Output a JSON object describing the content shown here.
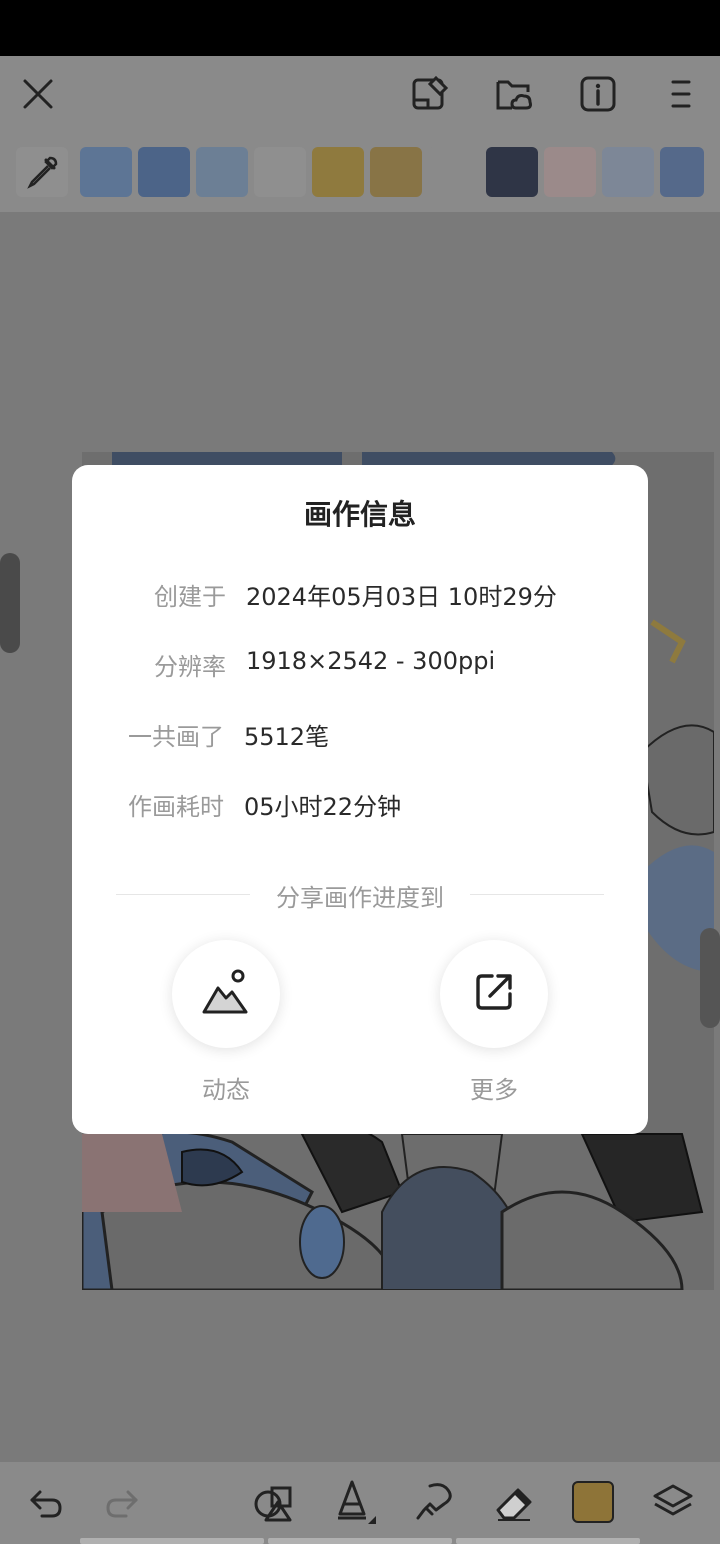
{
  "toolbar": {
    "icons": [
      "close-icon",
      "import-icon",
      "cloud-folder-icon",
      "info-icon",
      "menu-icon"
    ]
  },
  "palette": {
    "swatches": [
      "#5d7595",
      "#4c6488",
      "#6c7f95",
      "#8f8f8f",
      "#8f7a3e",
      "#887446",
      "#8a8a8a",
      "#2f3546",
      "#9b8a8a",
      "#7d8797",
      "#55698a"
    ]
  },
  "dialog": {
    "title": "画作信息",
    "rows": [
      {
        "label": "创建于",
        "value": "2024年05月03日 10时29分"
      },
      {
        "label": "分辨率",
        "value": "1918×2542 - 300ppi"
      },
      {
        "label": "一共画了",
        "value": "5512笔"
      },
      {
        "label": "作画耗时",
        "value": "05小时22分钟"
      }
    ],
    "share_heading": "分享画作进度到",
    "share_options": [
      {
        "label": "动态",
        "icon": "landscape-icon"
      },
      {
        "label": "更多",
        "icon": "external-share-icon"
      }
    ]
  },
  "bottom_toolbar": {
    "icons": [
      "undo-icon",
      "redo-icon",
      "shapes-icon",
      "pen-icon",
      "smudge-icon",
      "eraser-icon",
      "current-color-icon",
      "layers-icon"
    ],
    "current_color": "#8e7438"
  }
}
